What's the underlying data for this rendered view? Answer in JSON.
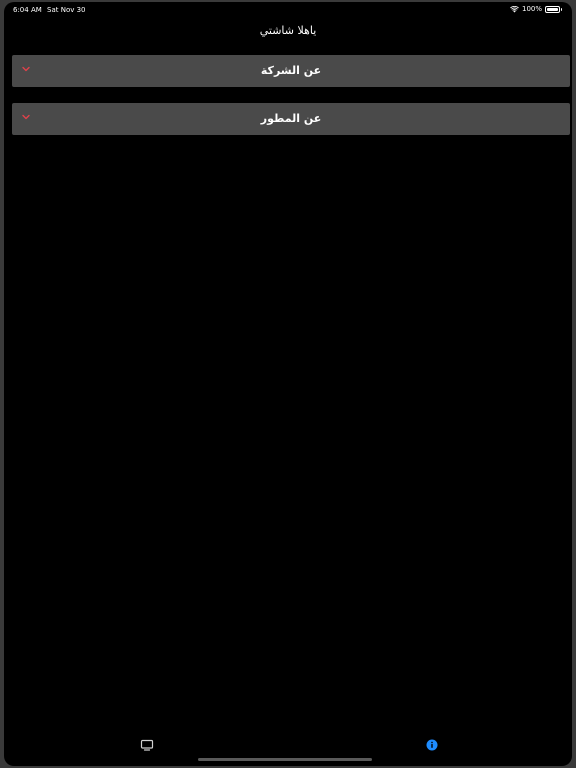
{
  "status_bar": {
    "time": "6:04 AM",
    "date": "Sat Nov 30",
    "battery": "100%",
    "battery_level": 1.0,
    "wifi_icon": "wifi-icon",
    "battery_icon": "battery-icon"
  },
  "nav": {
    "title": "ياهلا شاشتي"
  },
  "accordion": [
    {
      "label": "عن الشركة",
      "icon": "chevron-down-icon",
      "expanded": false
    },
    {
      "label": "عن المطور",
      "icon": "chevron-down-icon",
      "expanded": false
    }
  ],
  "tab_bar": {
    "tabs": [
      {
        "icon": "tv-icon",
        "selected": false
      },
      {
        "icon": "info-icon",
        "selected": true
      }
    ]
  },
  "colors": {
    "background": "#000000",
    "row_background": "#4a4a4a",
    "chevron": "#e0414a",
    "tab_selected": "#1e8cff",
    "tab_unselected": "#d0d0d0",
    "text": "#ffffff"
  }
}
